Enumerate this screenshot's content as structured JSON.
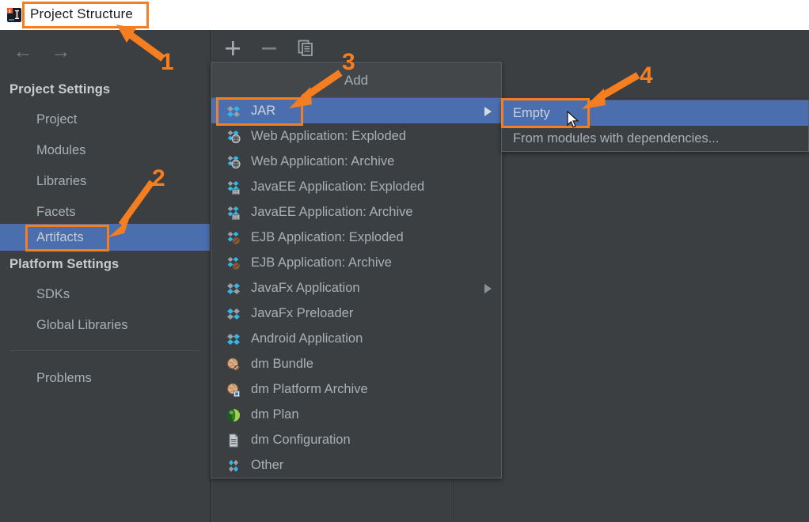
{
  "window": {
    "title": "Project Structure",
    "app_icon": "intellij-idea-icon"
  },
  "nav": {
    "back_icon": "arrow-left-icon",
    "forward_icon": "arrow-right-icon"
  },
  "sidebar": {
    "groups": [
      {
        "title": "Project Settings",
        "items": [
          {
            "label": "Project",
            "selected": false
          },
          {
            "label": "Modules",
            "selected": false
          },
          {
            "label": "Libraries",
            "selected": false
          },
          {
            "label": "Facets",
            "selected": false
          },
          {
            "label": "Artifacts",
            "selected": true
          }
        ]
      },
      {
        "title": "Platform Settings",
        "items": [
          {
            "label": "SDKs",
            "selected": false
          },
          {
            "label": "Global Libraries",
            "selected": false
          }
        ]
      }
    ],
    "footer_items": [
      {
        "label": "Problems",
        "selected": false
      }
    ]
  },
  "toolbar": {
    "buttons": [
      {
        "name": "add-button",
        "icon": "plus-icon"
      },
      {
        "name": "remove-button",
        "icon": "minus-icon"
      },
      {
        "name": "copy-button",
        "icon": "copy-icon"
      }
    ]
  },
  "add_menu": {
    "header": "Add",
    "items": [
      {
        "label": "JAR",
        "icon": "artifact-jar-icon",
        "selected": true,
        "submenu": true
      },
      {
        "label": "Web Application: Exploded",
        "icon": "artifact-web-icon",
        "selected": false,
        "submenu": false
      },
      {
        "label": "Web Application: Archive",
        "icon": "artifact-web-icon",
        "selected": false,
        "submenu": false
      },
      {
        "label": "JavaEE Application: Exploded",
        "icon": "artifact-javaee-icon",
        "selected": false,
        "submenu": false
      },
      {
        "label": "JavaEE Application: Archive",
        "icon": "artifact-javaee-icon",
        "selected": false,
        "submenu": false
      },
      {
        "label": "EJB Application: Exploded",
        "icon": "artifact-ejb-icon",
        "selected": false,
        "submenu": false
      },
      {
        "label": "EJB Application: Archive",
        "icon": "artifact-ejb-icon",
        "selected": false,
        "submenu": false
      },
      {
        "label": "JavaFx Application",
        "icon": "artifact-javafx-icon",
        "selected": false,
        "submenu": true
      },
      {
        "label": "JavaFx Preloader",
        "icon": "artifact-javafx-icon",
        "selected": false,
        "submenu": false
      },
      {
        "label": "Android Application",
        "icon": "artifact-android-icon",
        "selected": false,
        "submenu": false
      },
      {
        "label": "dm Bundle",
        "icon": "dm-bundle-icon",
        "selected": false,
        "submenu": false
      },
      {
        "label": "dm Platform Archive",
        "icon": "dm-platform-archive-icon",
        "selected": false,
        "submenu": false
      },
      {
        "label": "dm Plan",
        "icon": "dm-plan-icon",
        "selected": false,
        "submenu": false
      },
      {
        "label": "dm Configuration",
        "icon": "dm-configuration-icon",
        "selected": false,
        "submenu": false
      },
      {
        "label": "Other",
        "icon": "artifact-other-icon",
        "selected": false,
        "submenu": false
      }
    ]
  },
  "jar_submenu": {
    "items": [
      {
        "label": "Empty",
        "selected": true
      },
      {
        "label": "From modules with dependencies...",
        "selected": false
      }
    ]
  },
  "annotations": {
    "accent_color": "#f47e20",
    "markers": [
      {
        "number": "1",
        "target": "window-title"
      },
      {
        "number": "2",
        "target": "sidebar-item-artifacts"
      },
      {
        "number": "3",
        "target": "menu-item-jar"
      },
      {
        "number": "4",
        "target": "submenu-item-empty"
      }
    ]
  },
  "colors": {
    "background": "#3c3f41",
    "selection": "#4b6eaf",
    "text": "#a9b0b5",
    "titlebar": "#ffffff"
  },
  "cursor": {
    "icon": "mouse-pointer-icon"
  }
}
